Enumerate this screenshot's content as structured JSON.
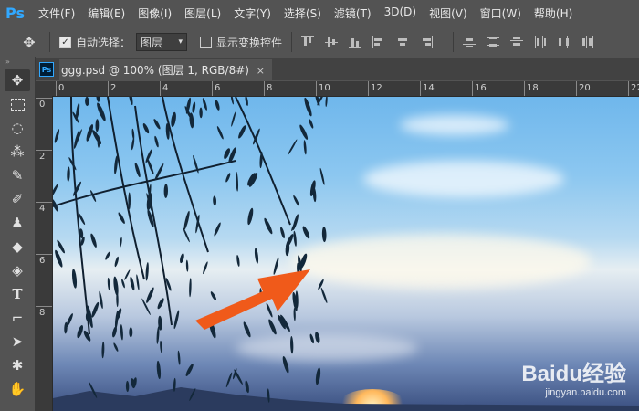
{
  "app": {
    "logo": "Ps"
  },
  "menu": [
    "文件(F)",
    "编辑(E)",
    "图像(I)",
    "图层(L)",
    "文字(Y)",
    "选择(S)",
    "滤镜(T)",
    "3D(D)",
    "视图(V)",
    "窗口(W)",
    "帮助(H)"
  ],
  "options": {
    "auto_select_label": "自动选择：",
    "auto_select_checked": true,
    "auto_select_target": "图层",
    "show_transform_label": "显示变换控件",
    "show_transform_checked": false
  },
  "document": {
    "tab_title": "ggg.psd @ 100% (图层 1, RGB/8#)",
    "close_glyph": "×"
  },
  "ruler": {
    "h_labels": [
      "0",
      "2",
      "4",
      "6",
      "8",
      "10",
      "12",
      "14",
      "16",
      "18",
      "20",
      "22"
    ],
    "v_labels": [
      "0",
      "2",
      "4",
      "6",
      "8"
    ]
  },
  "watermark": {
    "main": "Baidu经验",
    "sub": "jingyan.baidu.com"
  },
  "colors": {
    "arrow": "#f05a1a",
    "accent": "#31a8ff"
  }
}
